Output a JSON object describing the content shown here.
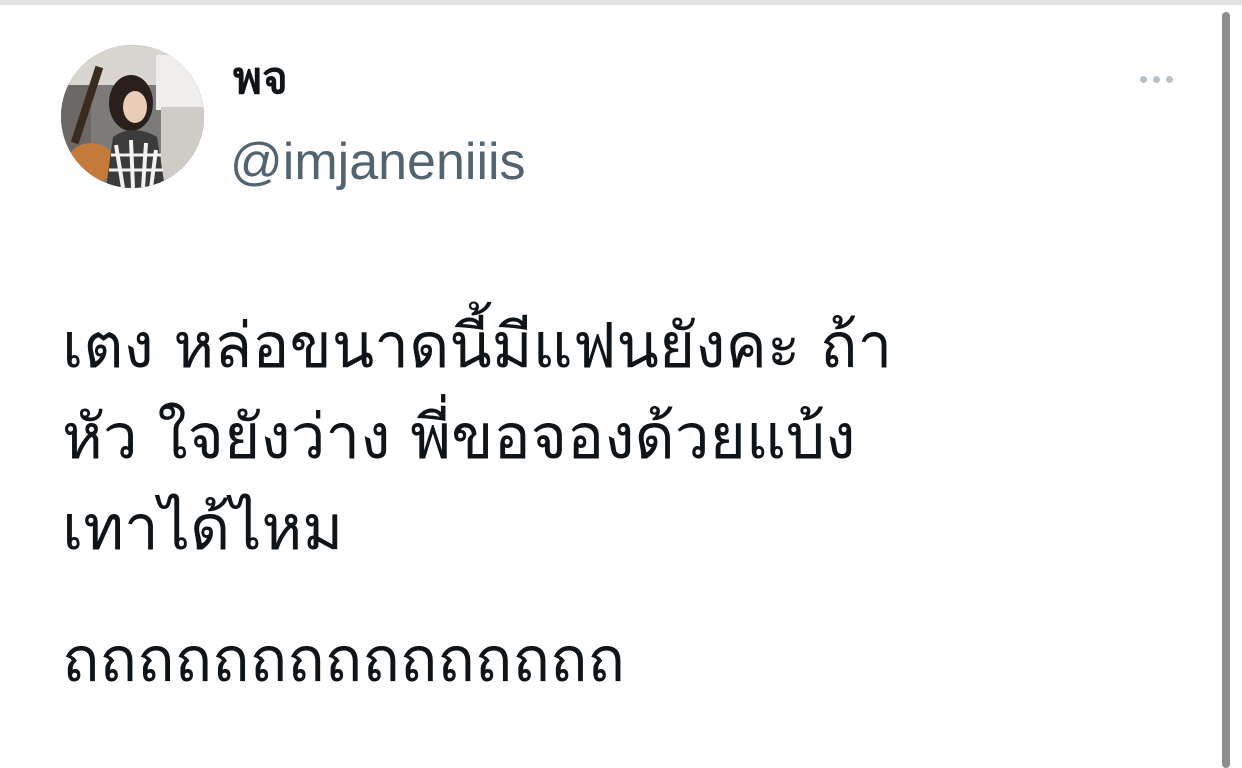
{
  "tweet": {
    "author": {
      "display_name": "พจ",
      "handle": "@imjaneniiis",
      "avatar_icon": "profile-photo"
    },
    "more_icon": "more-horizontal-icon",
    "text_lines": [
      "เตง หล่อขนาดนี้มีแฟนยังคะ ถ้า",
      "หัว ใจยังว่าง พี่ขอจองด้วยแบ้ง",
      "เทาได้ไหม",
      "ถถถถถถถถถถถถถถถ"
    ]
  },
  "colors": {
    "text_primary": "#0f1419",
    "text_secondary": "#536471",
    "more_dots": "#b9c1c8",
    "scrollbar": "#8e8e8e",
    "background": "#ffffff"
  }
}
